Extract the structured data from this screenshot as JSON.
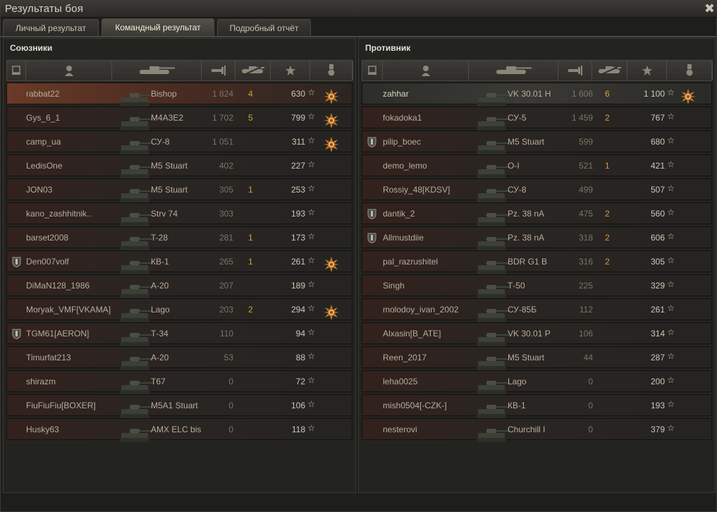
{
  "window": {
    "title": "Результаты боя",
    "close_icon": "✖"
  },
  "tabs": [
    {
      "label": "Личный результат",
      "active": false
    },
    {
      "label": "Командный результат",
      "active": true
    },
    {
      "label": "Подробный отчёт",
      "active": false
    }
  ],
  "allies": {
    "title": "Союзники",
    "rows": [
      {
        "name": "rabbat22",
        "vehicle": "Bishop",
        "damage": "1 824",
        "kills": "4",
        "xp": "630",
        "medal": true,
        "clan": false,
        "me": true
      },
      {
        "name": "Gys_6_1",
        "vehicle": "M4A3E2",
        "damage": "1 702",
        "kills": "5",
        "xp": "799",
        "medal": true,
        "clan": false
      },
      {
        "name": "camp_ua",
        "vehicle": "СУ-8",
        "damage": "1 051",
        "kills": "",
        "xp": "311",
        "medal": true,
        "clan": false
      },
      {
        "name": "LedisOne",
        "vehicle": "M5 Stuart",
        "damage": "402",
        "kills": "",
        "xp": "227",
        "medal": false,
        "clan": false
      },
      {
        "name": "JON03",
        "vehicle": "M5 Stuart",
        "damage": "305",
        "kills": "1",
        "xp": "253",
        "medal": false,
        "clan": false
      },
      {
        "name": "kano_zashhitnik..",
        "vehicle": "Strv 74",
        "damage": "303",
        "kills": "",
        "xp": "193",
        "medal": false,
        "clan": false
      },
      {
        "name": "barset2008",
        "vehicle": "T-28",
        "damage": "281",
        "kills": "1",
        "xp": "173",
        "medal": false,
        "clan": false
      },
      {
        "name": "Den007volf",
        "vehicle": "КВ-1",
        "damage": "265",
        "kills": "1",
        "xp": "261",
        "medal": true,
        "clan": true
      },
      {
        "name": "DiMaN128_1986",
        "vehicle": "А-20",
        "damage": "207",
        "kills": "",
        "xp": "189",
        "medal": false,
        "clan": false
      },
      {
        "name": "Moryak_VMF[VKAMA]",
        "vehicle": "Lago",
        "damage": "203",
        "kills": "2",
        "xp": "294",
        "medal": true,
        "clan": false
      },
      {
        "name": "TGM61[AERON]",
        "vehicle": "Т-34",
        "damage": "110",
        "kills": "",
        "xp": "94",
        "medal": false,
        "clan": true
      },
      {
        "name": "Timurfat213",
        "vehicle": "А-20",
        "damage": "53",
        "kills": "",
        "xp": "88",
        "medal": false,
        "clan": false
      },
      {
        "name": "shirazm",
        "vehicle": "T67",
        "damage": "0",
        "kills": "",
        "xp": "72",
        "medal": false,
        "clan": false
      },
      {
        "name": "FiuFiuFiu[BOXER]",
        "vehicle": "M5A1 Stuart",
        "damage": "0",
        "kills": "",
        "xp": "106",
        "medal": false,
        "clan": false
      },
      {
        "name": "Husky63",
        "vehicle": "AMX ELC bis",
        "damage": "0",
        "kills": "",
        "xp": "118",
        "medal": false,
        "clan": false
      }
    ]
  },
  "enemies": {
    "title": "Противник",
    "rows": [
      {
        "name": "zahhar",
        "vehicle": "VK 30.01 H",
        "damage": "1 606",
        "kills": "6",
        "xp": "1 100",
        "medal": true,
        "clan": false,
        "top": true
      },
      {
        "name": "fokadoka1",
        "vehicle": "СУ-5",
        "damage": "1 459",
        "kills": "2",
        "xp": "767",
        "medal": false,
        "clan": false
      },
      {
        "name": "pilip_boec",
        "vehicle": "M5 Stuart",
        "damage": "599",
        "kills": "",
        "xp": "680",
        "medal": false,
        "clan": true
      },
      {
        "name": "demo_lemo",
        "vehicle": "O-I",
        "damage": "521",
        "kills": "1",
        "xp": "421",
        "medal": false,
        "clan": false
      },
      {
        "name": "Rossiy_48[KDSV]",
        "vehicle": "СУ-8",
        "damage": "499",
        "kills": "",
        "xp": "507",
        "medal": false,
        "clan": false
      },
      {
        "name": "dantik_2",
        "vehicle": "Pz. 38 nA",
        "damage": "475",
        "kills": "2",
        "xp": "560",
        "medal": false,
        "clan": true
      },
      {
        "name": "Allmustdiie",
        "vehicle": "Pz. 38 nA",
        "damage": "318",
        "kills": "2",
        "xp": "606",
        "medal": false,
        "clan": true
      },
      {
        "name": "pal_razrushitel",
        "vehicle": "BDR G1 B",
        "damage": "316",
        "kills": "2",
        "xp": "305",
        "medal": false,
        "clan": false
      },
      {
        "name": "Singh",
        "vehicle": "Т-50",
        "damage": "225",
        "kills": "",
        "xp": "329",
        "medal": false,
        "clan": false
      },
      {
        "name": "molodoy_ivan_2002",
        "vehicle": "СУ-85Б",
        "damage": "112",
        "kills": "",
        "xp": "261",
        "medal": false,
        "clan": false
      },
      {
        "name": "Alxasin[B_ATE]",
        "vehicle": "VK 30.01 P",
        "damage": "106",
        "kills": "",
        "xp": "314",
        "medal": false,
        "clan": false
      },
      {
        "name": "Reen_2017",
        "vehicle": "M5 Stuart",
        "damage": "44",
        "kills": "",
        "xp": "287",
        "medal": false,
        "clan": false
      },
      {
        "name": "leha0025",
        "vehicle": "Lago",
        "damage": "0",
        "kills": "",
        "xp": "200",
        "medal": false,
        "clan": false
      },
      {
        "name": "mish0504[-CZK-]",
        "vehicle": "КВ-1",
        "damage": "0",
        "kills": "",
        "xp": "193",
        "medal": false,
        "clan": false
      },
      {
        "name": "nesterovi",
        "vehicle": "Churchill I",
        "damage": "0",
        "kills": "",
        "xp": "379",
        "medal": false,
        "clan": false
      }
    ]
  },
  "icons": {
    "star": "☆",
    "column_icons": [
      "squad-icon",
      "player-icon",
      "tank-icon",
      "damage-icon",
      "kills-icon",
      "xp-star-icon",
      "medal-icon"
    ]
  }
}
